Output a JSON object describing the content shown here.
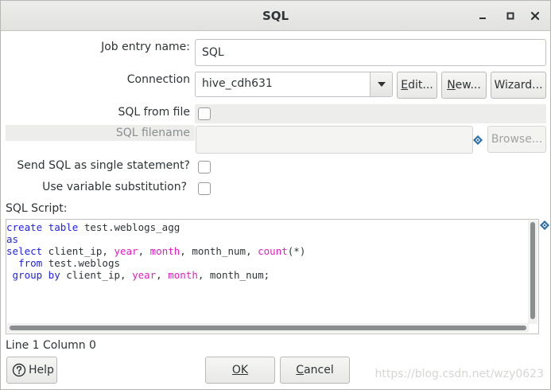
{
  "window": {
    "title": "SQL"
  },
  "form": {
    "job_entry_name_label": "Job entry name:",
    "job_entry_name_value": "SQL",
    "connection_label": "Connection",
    "connection_value": "hive_cdh631",
    "edit_button": "Edit...",
    "new_button": "New...",
    "wizard_button": "Wizard...",
    "sql_from_file_label": "SQL from file",
    "sql_filename_label": "SQL filename",
    "sql_filename_value": "",
    "browse_button": "Browse...",
    "send_single_label": "Send SQL as single statement?",
    "variable_sub_label": "Use variable substitution?",
    "sql_script_label": "SQL Script:"
  },
  "checkboxes": {
    "sql_from_file": false,
    "send_single": false,
    "variable_sub": false
  },
  "script": {
    "lines": [
      [
        {
          "t": "create",
          "c": "blue"
        },
        {
          "t": " "
        },
        {
          "t": "table",
          "c": "blue"
        },
        {
          "t": " test.weblogs_agg"
        }
      ],
      [
        {
          "t": "as",
          "c": "blue"
        }
      ],
      [
        {
          "t": "select",
          "c": "blue"
        },
        {
          "t": " client_ip, "
        },
        {
          "t": "year",
          "c": "pink"
        },
        {
          "t": ", "
        },
        {
          "t": "month",
          "c": "pink"
        },
        {
          "t": ", month_num, "
        },
        {
          "t": "count",
          "c": "pink"
        },
        {
          "t": "(*)"
        }
      ],
      [
        {
          "t": "  "
        },
        {
          "t": "from",
          "c": "blue"
        },
        {
          "t": " test.weblogs"
        }
      ],
      [
        {
          "t": " "
        },
        {
          "t": "group by",
          "c": "blue"
        },
        {
          "t": " client_ip, "
        },
        {
          "t": "year",
          "c": "pink"
        },
        {
          "t": ", "
        },
        {
          "t": "month",
          "c": "pink"
        },
        {
          "t": ", month_num;"
        }
      ]
    ]
  },
  "status": {
    "position_text": "Line 1 Column 0"
  },
  "footer": {
    "help_button": "Help",
    "ok_button": "OK",
    "cancel_button": "Cancel",
    "watermark": "https://blog.csdn.net/wzy0623"
  },
  "colors": {
    "keyword_blue": "#2222ee",
    "keyword_pink": "#e020c0",
    "variable_icon": "#2a6fa8"
  },
  "icons": {
    "minimize": "minimize-icon",
    "maximize": "maximize-icon",
    "close": "close-icon",
    "combo": "chevron-down-icon",
    "variable": "variable-diamond-icon",
    "help": "question-circle-icon"
  }
}
